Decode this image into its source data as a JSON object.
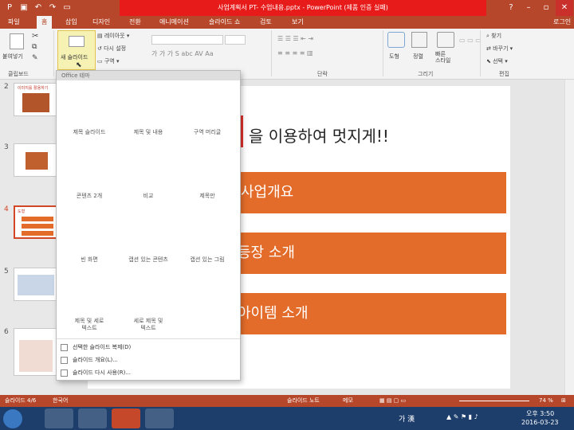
{
  "titlebar": {
    "title": "사업계획서 PT- 수업내용.pptx - PowerPoint (제품 인증 실패)",
    "help": "?",
    "minimize": "–",
    "restore": "▫",
    "close": "✕"
  },
  "tabs": [
    "파일",
    "홈",
    "삽입",
    "디자인",
    "전환",
    "애니메이션",
    "슬라이드 쇼",
    "검토",
    "보기"
  ],
  "account": "로그인",
  "ribbon": {
    "paste": "붙여넣기",
    "new_slide": "새 슬라이드",
    "layout": "레이아웃",
    "reset": "다시 설정",
    "section": "구역",
    "shape": "도형",
    "arrange": "정렬",
    "quick_styles": "빠른\n스타일",
    "find": "찾기",
    "replace": "바꾸기",
    "select": "선택",
    "groups": {
      "clipboard": "클립보드",
      "paragraph": "단락",
      "drawing": "그리기",
      "editing": "편집"
    }
  },
  "dropdown": {
    "header": "Office 테마",
    "layouts": [
      "제목 슬라이드",
      "제목 및 내용",
      "구역 머리글",
      "콘텐츠 2개",
      "비교",
      "제목만",
      "빈 화면",
      "캡션 있는 콘텐츠",
      "캡션 있는 그림",
      "제목 및 세로\n텍스트",
      "세로 제목 및\n텍스트"
    ],
    "commands": [
      "선택한 슬라이드 복제(D)",
      "슬라이드 개요(L)...",
      "슬라이드 다시 사용(R)..."
    ]
  },
  "thumbs": {
    "numbers": [
      "2",
      "3",
      "4",
      "5",
      "6"
    ],
    "thumb2_title": "이미지를 활용하기",
    "thumb4_title": "도형"
  },
  "slide": {
    "title": "을 이용하여 멋지게!!",
    "bars": [
      "사업개요",
      "등장 소개",
      "아이템 소개"
    ]
  },
  "status": {
    "slide": "슬라이드 4/6",
    "lang": "한국어",
    "notes": "슬라이드 노트",
    "comments": "메모",
    "zoom": "74 %"
  },
  "taskbar": {
    "time": "오후 3:50",
    "date": "2016-03-23",
    "ime": "가 漢"
  },
  "colors": {
    "accent": "#b7472a",
    "bar": "#e46c2a",
    "highlight": "#f6f2b4"
  }
}
